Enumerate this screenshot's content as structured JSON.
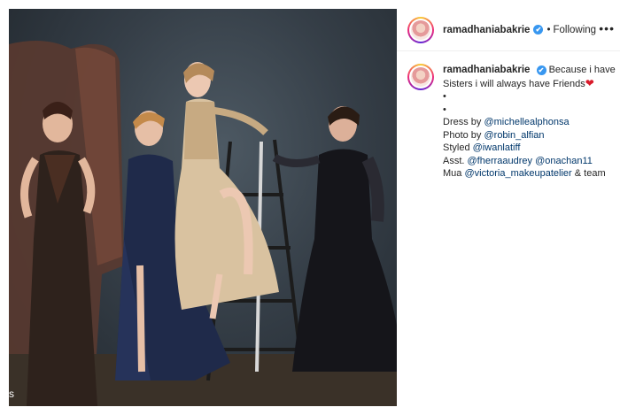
{
  "post": {
    "username": "ramadhaniabakrie",
    "verified_mark": "✔",
    "separator": "•",
    "follow_status": "Following",
    "more_icon": "•••"
  },
  "caption": {
    "username": "ramadhaniabakrie",
    "line1": "Because i have",
    "line2": "Sisters i will always have Friends",
    "heart": "❤",
    "bullet1": "•",
    "bullet2": "•",
    "dress_prefix": "Dress by ",
    "dress_mention": "@michellealphonsa",
    "photo_prefix": "Photo by ",
    "photo_mention": "@robin_alfian",
    "styled_prefix": "Styled ",
    "styled_mention": "@iwanlatiff",
    "asst_prefix": "Asst. ",
    "asst_mention1": "@fherraaudrey",
    "asst_mention2": "@onachan11",
    "mua_prefix": "Mua ",
    "mua_mention": "@victoria_makeupatelier",
    "mua_suffix": " & team"
  },
  "photo": {
    "corner_glyph": "s"
  },
  "colors": {
    "link": "#00376b",
    "verified": "#3897f0",
    "heart": "#d91a2a"
  }
}
